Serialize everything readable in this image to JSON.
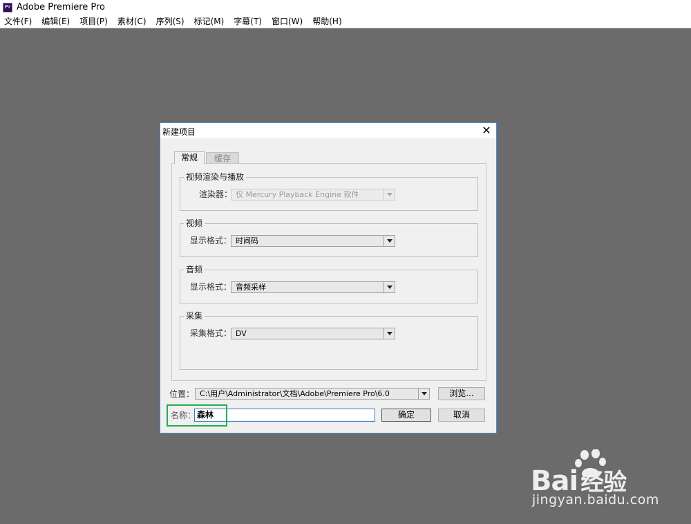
{
  "app": {
    "logo_text": "Pr",
    "title": "Adobe Premiere Pro"
  },
  "menu": [
    "文件(F)",
    "编辑(E)",
    "项目(P)",
    "素材(C)",
    "序列(S)",
    "标记(M)",
    "字幕(T)",
    "窗口(W)",
    "帮助(H)"
  ],
  "dialog": {
    "title": "新建项目",
    "close": "✕",
    "tabs": {
      "general": "常规",
      "cache": "缓存"
    },
    "render_group": {
      "title": "视频渲染与播放",
      "renderer_label": "渲染器：",
      "renderer_value": "仅 Mercury Playback Engine 软件"
    },
    "video_group": {
      "title": "视频",
      "format_label": "显示格式：",
      "format_value": "时间码"
    },
    "audio_group": {
      "title": "音频",
      "format_label": "显示格式：",
      "format_value": "音频采样"
    },
    "capture_group": {
      "title": "采集",
      "format_label": "采集格式：",
      "format_value": "DV"
    },
    "location": {
      "label": "位置：",
      "value": "C:\\用户\\Administrator\\文档\\Adobe\\Premiere Pro\\6.0",
      "browse": "浏览..."
    },
    "name": {
      "label": "名称：",
      "value": "森林"
    },
    "ok": "确定",
    "cancel": "取消"
  },
  "watermark": {
    "brand": "Bai",
    "brand_cn": "经验",
    "url": "jingyan.baidu.com"
  },
  "colors": {
    "background": "#6b6b6b",
    "dialog_border": "#4a8fd6",
    "highlight": "#22b14c",
    "app_logo": "#2a1147"
  }
}
